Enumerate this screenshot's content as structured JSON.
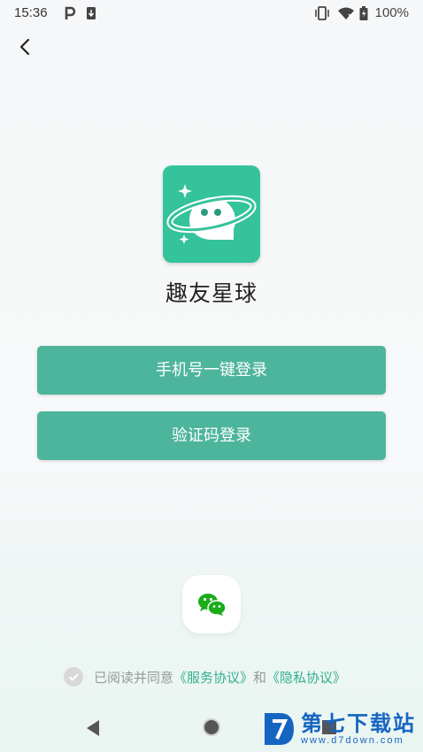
{
  "status_bar": {
    "time": "15:36",
    "battery": "100%"
  },
  "app": {
    "name": "趣友星球"
  },
  "buttons": {
    "one_click": "手机号一键登录",
    "code_login": "验证码登录"
  },
  "agreement": {
    "prefix": "已阅读并同意",
    "service": "《服务协议》",
    "and": "和",
    "privacy": "《隐私协议》"
  },
  "watermark": {
    "brand": "第七下载站",
    "url": "www.d7down.com"
  },
  "colors": {
    "accent": "#4db59b",
    "logo_bg": "#34c39a",
    "link": "#35b08c"
  }
}
